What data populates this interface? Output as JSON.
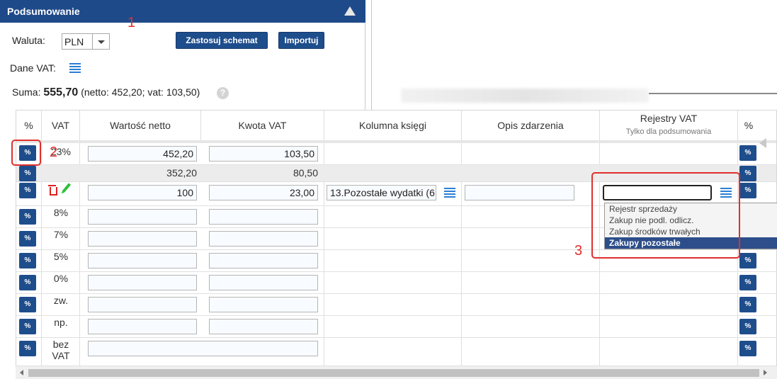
{
  "panel": {
    "title": "Podsumowanie"
  },
  "currency": {
    "label": "Waluta:",
    "value": "PLN"
  },
  "buttons": {
    "apply_schema": "Zastosuj schemat",
    "import": "Importuj"
  },
  "vat_data": {
    "label": "Dane VAT:"
  },
  "summary": {
    "prefix": "Suma:",
    "total": "555,70",
    "detail": "(netto: 452,20; vat: 103,50)",
    "help": "?"
  },
  "table": {
    "headers": {
      "pct": "%",
      "vat": "VAT",
      "net": "Wartość netto",
      "vat_amount": "Kwota VAT",
      "ledger_column": "Kolumna księgi",
      "event_desc": "Opis zdarzenia",
      "vat_registers": "Rejestry VAT",
      "vat_registers_sub": "Tylko dla podsumowania",
      "pct_right": "%"
    },
    "pct_button": "%",
    "row1": {
      "vat": "23%",
      "net": "452,20",
      "vat_amount": "103,50"
    },
    "row2": {
      "net": "352,20",
      "vat_amount": "80,50"
    },
    "row3": {
      "net": "100",
      "vat_amount": "23,00",
      "ledger": "13.Pozostałe wydatki (6"
    },
    "rates": [
      "8%",
      "7%",
      "5%",
      "0%",
      "zw.",
      "np."
    ],
    "bez_vat": [
      "bez",
      "VAT"
    ]
  },
  "dropdown": {
    "options": [
      "Rejestr sprzedaży",
      "Zakup nie podl. odlicz.",
      "Zakup środków trwałych",
      "Zakupy pozostałe"
    ],
    "selected_index": 3
  },
  "annotations": [
    "1",
    "2",
    "3"
  ],
  "colors": {
    "header": "#1f4a8a",
    "button": "#1e4d8c",
    "annotation": "#e0302c",
    "icon_list": "#2a7fd4",
    "trash": "#e02020",
    "pencil": "#2fbf3a"
  }
}
